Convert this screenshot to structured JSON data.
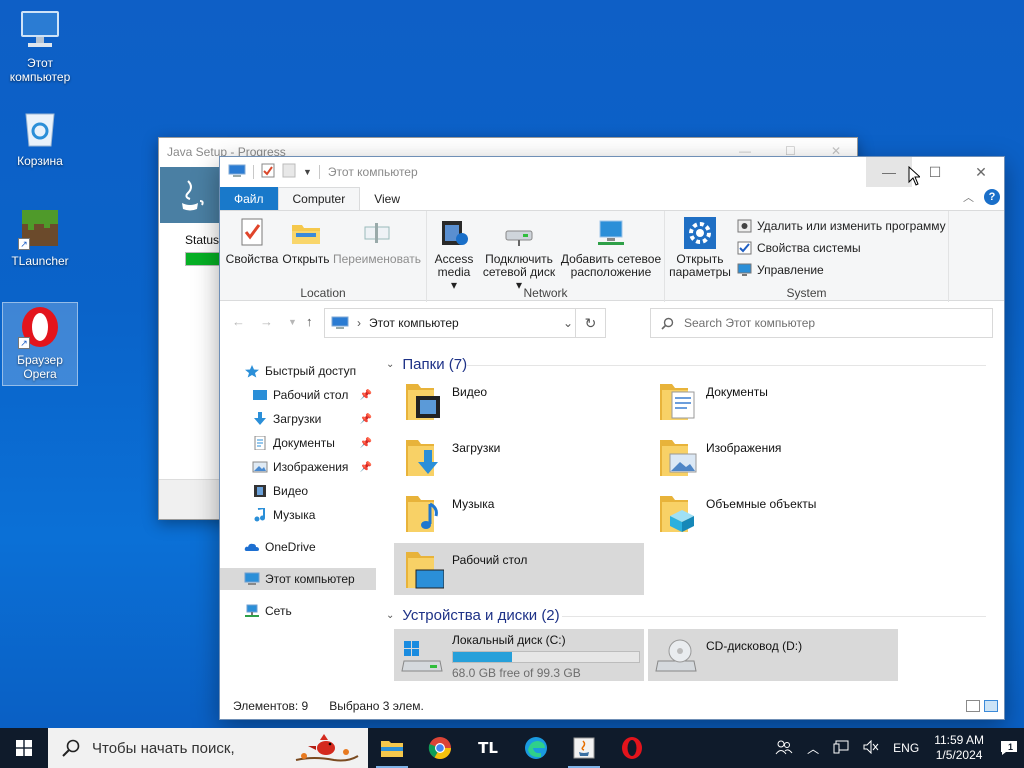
{
  "desktop": {
    "icons": [
      {
        "label": "Этот компьютер"
      },
      {
        "label": "Корзина"
      },
      {
        "label": "TLauncher"
      },
      {
        "label": "Браузер Opera"
      }
    ]
  },
  "java_window": {
    "title": "Java Setup - Progress",
    "status_label": "Status",
    "progress_fraction": 0.05
  },
  "explorer": {
    "title": "Этот компьютер",
    "tabs": [
      "Файл",
      "Computer",
      "View"
    ],
    "ribbon": {
      "location": {
        "label": "Location",
        "buttons": [
          "Свойства",
          "Открыть",
          "Переименовать"
        ]
      },
      "network": {
        "label": "Network",
        "buttons": [
          "Access media ▾",
          "Подключить сетевой диск ▾",
          "Добавить сетевое расположение"
        ],
        "access_line1": "Access",
        "access_line2": "media ▾",
        "map_line1": "Подключить",
        "map_line2": "сетевой диск ▾",
        "add_line1": "Добавить сетевое",
        "add_line2": "расположение"
      },
      "system": {
        "label": "System",
        "open_line1": "Открыть",
        "open_line2": "параметры",
        "items": [
          "Удалить или изменить программу",
          "Свойства системы",
          "Управление"
        ]
      }
    },
    "address": "Этот компьютер",
    "search_placeholder": "Search Этот компьютер",
    "nav": [
      {
        "label": "Быстрый доступ"
      },
      {
        "label": "Рабочий стол"
      },
      {
        "label": "Загрузки"
      },
      {
        "label": "Документы"
      },
      {
        "label": "Изображения"
      },
      {
        "label": "Видео"
      },
      {
        "label": "Музыка"
      },
      {
        "label": "OneDrive"
      },
      {
        "label": "Этот компьютер"
      },
      {
        "label": "Сеть"
      }
    ],
    "folders_header": "Папки (7)",
    "folders": [
      "Видео",
      "Документы",
      "Загрузки",
      "Изображения",
      "Музыка",
      "Объемные объекты",
      "Рабочий стол"
    ],
    "devices_header": "Устройства и диски (2)",
    "drives": [
      {
        "name": "Локальный диск (C:)",
        "free": "68.0 GB free of 99.3 GB",
        "used_fraction": 0.315
      },
      {
        "name": "CD-дисковод (D:)"
      }
    ],
    "status": {
      "items": "Элементов: 9",
      "selected": "Выбрано 3 элем."
    }
  },
  "taskbar": {
    "search_placeholder": "Чтобы начать поиск,",
    "apps": [
      "file-explorer",
      "chrome",
      "tlauncher",
      "edge",
      "java-setup",
      "opera"
    ],
    "tlauncher_label": "TL",
    "language": "ENG",
    "time": "11:59 AM",
    "date": "1/5/2024",
    "notification_count": "1"
  },
  "colors": {
    "accent": "#1979ca",
    "selection": "#d9d9d9",
    "drive_bar": "#26a0da",
    "folder": "#f5c84c"
  }
}
